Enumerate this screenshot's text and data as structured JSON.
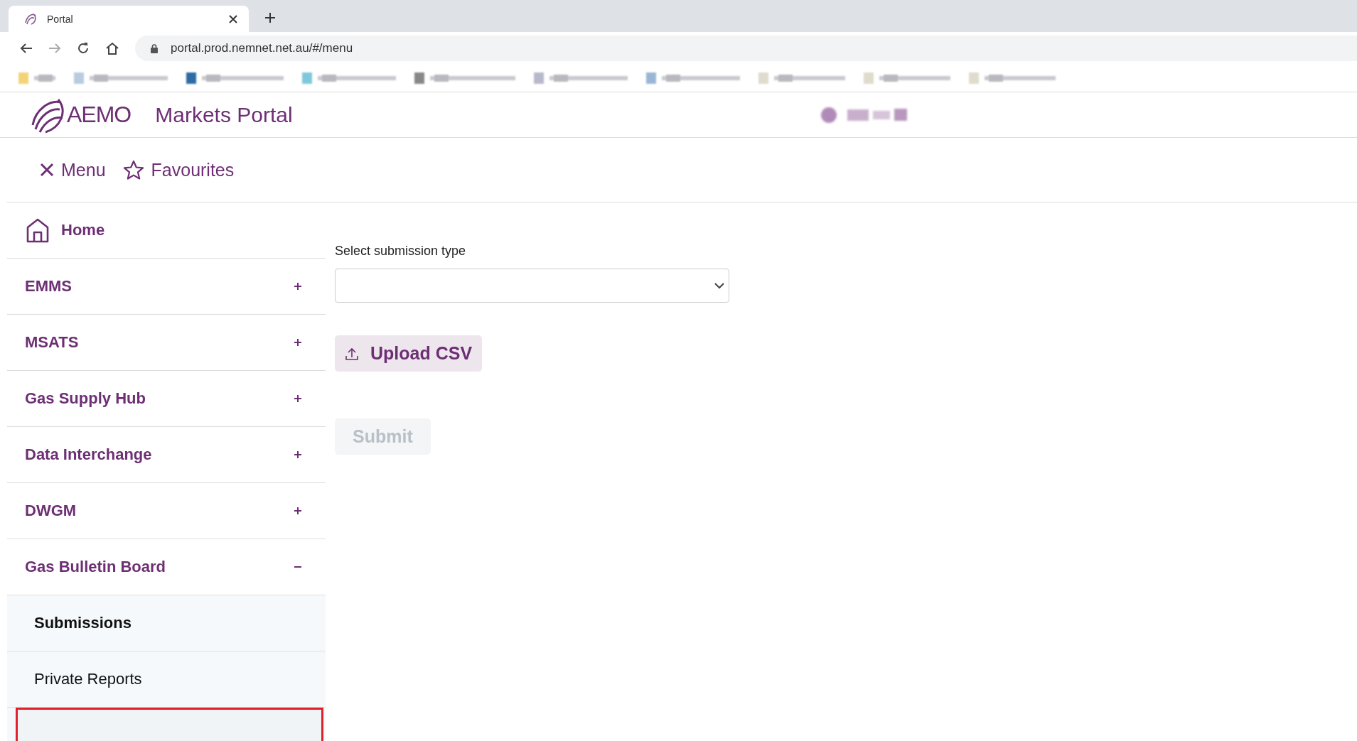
{
  "browser": {
    "tab_title": "Portal",
    "url": "portal.prod.nemnet.net.au/#/menu"
  },
  "header": {
    "logo": "AEMO",
    "title": "Markets Portal"
  },
  "toolbar": [
    {
      "kind": "close",
      "label": "Menu"
    },
    {
      "kind": "star",
      "label": "Favourites"
    }
  ],
  "sidebar": {
    "home": "Home",
    "items": [
      {
        "label": "EMMS",
        "expanded": false
      },
      {
        "label": "MSATS",
        "expanded": false
      },
      {
        "label": "Gas Supply Hub",
        "expanded": false
      },
      {
        "label": "Data Interchange",
        "expanded": false
      },
      {
        "label": "DWGM",
        "expanded": false
      },
      {
        "label": "Gas Bulletin Board",
        "expanded": true,
        "children": [
          {
            "label": "Submissions",
            "selected": true
          },
          {
            "label": "Private Reports",
            "selected": false
          }
        ]
      }
    ]
  },
  "form": {
    "label": "Select submission type",
    "upload": "Upload CSV",
    "submit": {
      "label": "Submit",
      "disabled": true
    }
  },
  "annotation": {
    "kind": "highlight"
  }
}
